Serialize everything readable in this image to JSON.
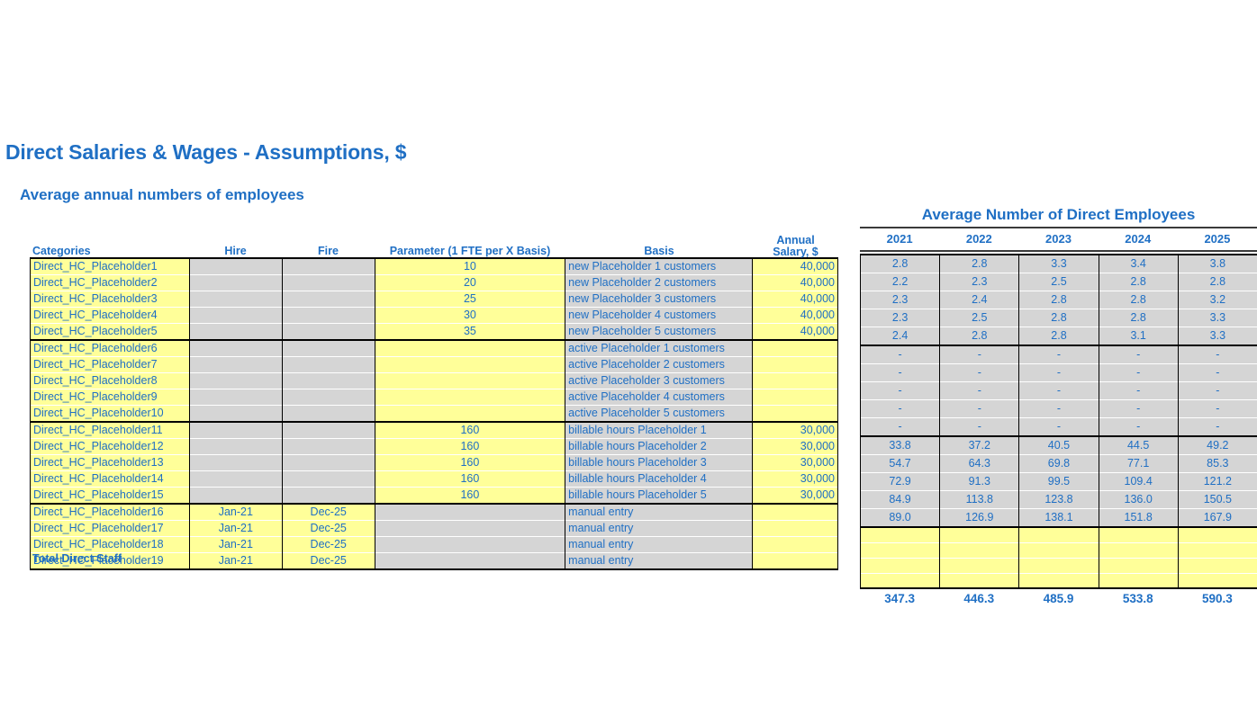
{
  "title": "Direct Salaries & Wages - Assumptions, $",
  "subtitle": "Average annual numbers of employees",
  "left_table": {
    "headers": {
      "categories": "Categories",
      "hire": "Hire",
      "fire": "Fire",
      "parameter": "Parameter (1 FTE per X Basis)",
      "basis": "Basis",
      "annual_salary_line1": "Annual",
      "annual_salary_line2": "Salary, $"
    },
    "rows": [
      {
        "category": "Direct_HC_Placeholder1",
        "hire": "",
        "fire": "",
        "parameter": "10",
        "basis": "new Placeholder 1 customers",
        "salary": "40,000"
      },
      {
        "category": "Direct_HC_Placeholder2",
        "hire": "",
        "fire": "",
        "parameter": "20",
        "basis": "new Placeholder 2 customers",
        "salary": "40,000"
      },
      {
        "category": "Direct_HC_Placeholder3",
        "hire": "",
        "fire": "",
        "parameter": "25",
        "basis": "new Placeholder 3 customers",
        "salary": "40,000"
      },
      {
        "category": "Direct_HC_Placeholder4",
        "hire": "",
        "fire": "",
        "parameter": "30",
        "basis": "new Placeholder 4 customers",
        "salary": "40,000"
      },
      {
        "category": "Direct_HC_Placeholder5",
        "hire": "",
        "fire": "",
        "parameter": "35",
        "basis": "new Placeholder 5 customers",
        "salary": "40,000"
      },
      {
        "category": "Direct_HC_Placeholder6",
        "hire": "",
        "fire": "",
        "parameter": "",
        "basis": "active Placeholder 1 customers",
        "salary": ""
      },
      {
        "category": "Direct_HC_Placeholder7",
        "hire": "",
        "fire": "",
        "parameter": "",
        "basis": "active Placeholder 2 customers",
        "salary": ""
      },
      {
        "category": "Direct_HC_Placeholder8",
        "hire": "",
        "fire": "",
        "parameter": "",
        "basis": "active Placeholder 3 customers",
        "salary": ""
      },
      {
        "category": "Direct_HC_Placeholder9",
        "hire": "",
        "fire": "",
        "parameter": "",
        "basis": "active Placeholder 4 customers",
        "salary": ""
      },
      {
        "category": "Direct_HC_Placeholder10",
        "hire": "",
        "fire": "",
        "parameter": "",
        "basis": "active Placeholder 5 customers",
        "salary": ""
      },
      {
        "category": "Direct_HC_Placeholder11",
        "hire": "",
        "fire": "",
        "parameter": "160",
        "basis": "billable hours Placeholder 1",
        "salary": "30,000"
      },
      {
        "category": "Direct_HC_Placeholder12",
        "hire": "",
        "fire": "",
        "parameter": "160",
        "basis": "billable hours Placeholder 2",
        "salary": "30,000"
      },
      {
        "category": "Direct_HC_Placeholder13",
        "hire": "",
        "fire": "",
        "parameter": "160",
        "basis": "billable hours Placeholder 3",
        "salary": "30,000"
      },
      {
        "category": "Direct_HC_Placeholder14",
        "hire": "",
        "fire": "",
        "parameter": "160",
        "basis": "billable hours Placeholder 4",
        "salary": "30,000"
      },
      {
        "category": "Direct_HC_Placeholder15",
        "hire": "",
        "fire": "",
        "parameter": "160",
        "basis": "billable hours Placeholder 5",
        "salary": "30,000"
      },
      {
        "category": "Direct_HC_Placeholder16",
        "hire": "Jan-21",
        "fire": "Dec-25",
        "parameter": "",
        "basis": "manual entry",
        "salary": ""
      },
      {
        "category": "Direct_HC_Placeholder17",
        "hire": "Jan-21",
        "fire": "Dec-25",
        "parameter": "",
        "basis": "manual entry",
        "salary": ""
      },
      {
        "category": "Direct_HC_Placeholder18",
        "hire": "Jan-21",
        "fire": "Dec-25",
        "parameter": "",
        "basis": "manual entry",
        "salary": ""
      },
      {
        "category": "Direct_HC_Placeholder19",
        "hire": "Jan-21",
        "fire": "Dec-25",
        "parameter": "",
        "basis": "manual entry",
        "salary": ""
      }
    ],
    "total_label": "Total Direct Staff"
  },
  "right_panel": {
    "title": "Average Number of Direct Employees",
    "years": [
      "2021",
      "2022",
      "2023",
      "2024",
      "2025"
    ],
    "rows": [
      [
        "2.8",
        "2.8",
        "3.3",
        "3.4",
        "3.8"
      ],
      [
        "2.2",
        "2.3",
        "2.5",
        "2.8",
        "2.8"
      ],
      [
        "2.3",
        "2.4",
        "2.8",
        "2.8",
        "3.2"
      ],
      [
        "2.3",
        "2.5",
        "2.8",
        "2.8",
        "3.3"
      ],
      [
        "2.4",
        "2.8",
        "2.8",
        "3.1",
        "3.3"
      ],
      [
        "-",
        "-",
        "-",
        "-",
        "-"
      ],
      [
        "-",
        "-",
        "-",
        "-",
        "-"
      ],
      [
        "-",
        "-",
        "-",
        "-",
        "-"
      ],
      [
        "-",
        "-",
        "-",
        "-",
        "-"
      ],
      [
        "-",
        "-",
        "-",
        "-",
        "-"
      ],
      [
        "33.8",
        "37.2",
        "40.5",
        "44.5",
        "49.2"
      ],
      [
        "54.7",
        "64.3",
        "69.8",
        "77.1",
        "85.3"
      ],
      [
        "72.9",
        "91.3",
        "99.5",
        "109.4",
        "121.2"
      ],
      [
        "84.9",
        "113.8",
        "123.8",
        "136.0",
        "150.5"
      ],
      [
        "89.0",
        "126.9",
        "138.1",
        "151.8",
        "167.9"
      ],
      [
        "",
        "",
        "",
        "",
        ""
      ],
      [
        "",
        "",
        "",
        "",
        ""
      ],
      [
        "",
        "",
        "",
        "",
        ""
      ],
      [
        "",
        "",
        "",
        "",
        ""
      ]
    ],
    "totals": [
      "347.3",
      "446.3",
      "485.9",
      "533.8",
      "590.3"
    ]
  },
  "colors": {
    "accent_blue": "#1f6fc4",
    "input_yellow": "#ffff99",
    "formula_gray": "#d5d5d5",
    "border_black": "#000000"
  }
}
